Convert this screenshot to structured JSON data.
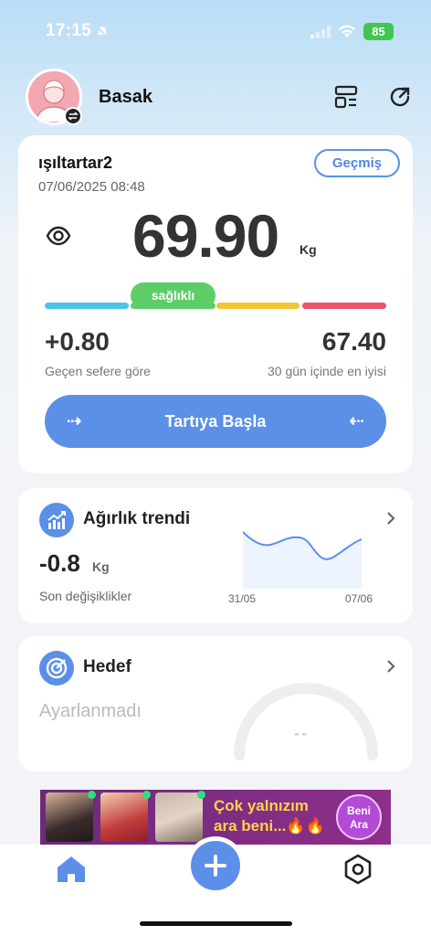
{
  "status_bar": {
    "time": "17:15",
    "battery": "85"
  },
  "header": {
    "username": "Basak"
  },
  "scale_card": {
    "device_name": "ışıltartar2",
    "date": "07/06/2025 08:48",
    "history_label": "Geçmiş",
    "weight": "69.90",
    "weight_unit": "Kg",
    "status_badge": "sağlıklı",
    "change_value": "+0.80",
    "change_label": "Geçen sefere göre",
    "best_value": "67.40",
    "best_label": "30 gün içinde en iyisi",
    "start_label": "Tartıya Başla",
    "colors": {
      "accent": "#5b8fe8",
      "bar_low": "#4ec3ea",
      "bar_normal": "#5dcd68",
      "bar_high": "#f5c436",
      "bar_obese": "#e8546a"
    }
  },
  "trend_card": {
    "title": "Ağırlık trendi",
    "value": "-0.8",
    "unit": "Kg",
    "label": "Son değişiklikler",
    "date_start": "31/05",
    "date_end": "07/06"
  },
  "goal_card": {
    "title": "Hedef",
    "status": "Ayarlanmadı",
    "value": "--"
  },
  "ad": {
    "text": "Çok yalnızım ara beni...🔥🔥",
    "button": "Beni Ara"
  },
  "tabs": [
    "home-icon",
    "add-icon",
    "settings-icon"
  ]
}
